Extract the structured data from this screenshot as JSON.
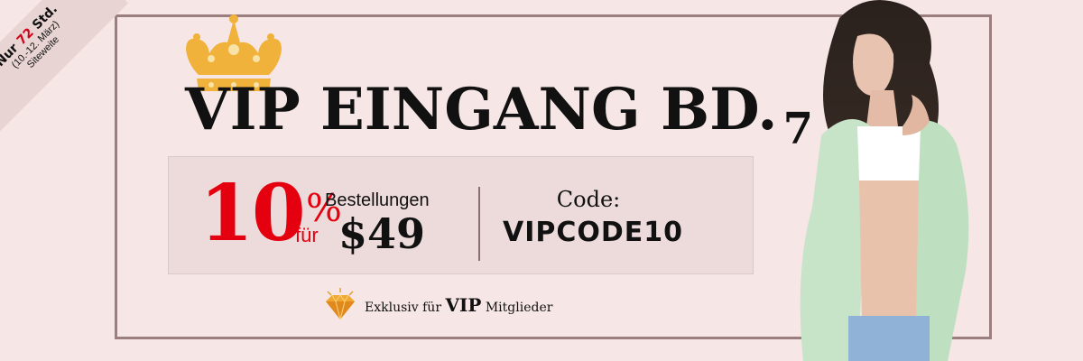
{
  "ribbon": {
    "line1_prefix": "Nur ",
    "line1_highlight": "72",
    "line1_suffix": " Std.",
    "line2": "(10.-12. März)",
    "line3": "Siteweite"
  },
  "title": {
    "main": "VIP EINGANG BD.",
    "number": "7"
  },
  "offer": {
    "percent": "10",
    "percent_sign": "%",
    "for_word": "für",
    "orders_label": "Bestellungen",
    "amount": "$49",
    "code_label": "Code:",
    "code_value": "VIPCODE10"
  },
  "footer": {
    "prefix": "Exklusiv für ",
    "vip": "VIP",
    "suffix": " Mitglieder"
  },
  "icons": {
    "crown": "crown-icon",
    "gem": "diamond-icon",
    "model": "fashion-model-photo"
  },
  "colors": {
    "background": "#f6e6e5",
    "frame": "#9b7f7f",
    "accent": "#e4000f",
    "crown": "#f0b23a",
    "offer_box": "#eddbdb",
    "ribbon": "#e8d4d3"
  }
}
